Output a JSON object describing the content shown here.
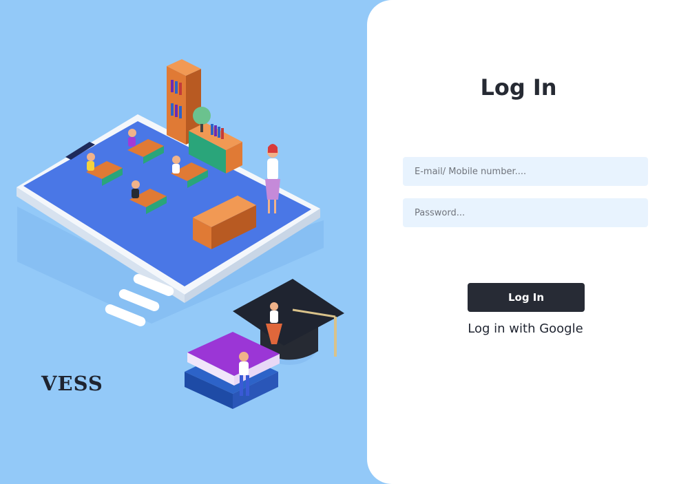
{
  "brand": {
    "name": "VESS"
  },
  "illustration": {
    "description_icon": "classroom-on-tablet-illustration"
  },
  "login": {
    "title": "Log In",
    "email_placeholder": "E-mail/ Mobile number....",
    "password_placeholder": "Password...",
    "submit_label": "Log In",
    "google_label": "Log in with Google"
  },
  "colors": {
    "left_bg": "#93c9f8",
    "right_bg": "#ffffff",
    "field_bg": "#e8f3fe",
    "button_bg": "#272b35",
    "text_dark": "#262a33"
  }
}
